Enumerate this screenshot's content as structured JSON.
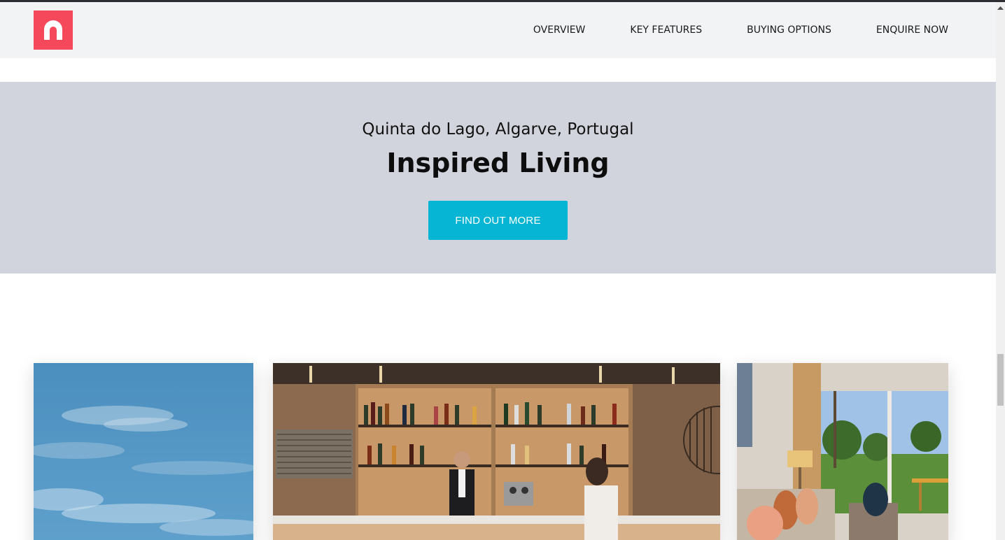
{
  "header": {
    "logo_name": "brand-logo",
    "nav": [
      {
        "label": "OVERVIEW"
      },
      {
        "label": "KEY FEATURES"
      },
      {
        "label": "BUYING OPTIONS"
      },
      {
        "label": "ENQUIRE NOW"
      }
    ]
  },
  "hero": {
    "location": "Quinta do Lago, Algarve, Portugal",
    "title": "Inspired Living",
    "cta_label": "FIND OUT MORE"
  },
  "colors": {
    "brand": "#f5485a",
    "accent": "#06b5d4",
    "hero_bg": "#d1d4dc",
    "header_bg": "#f2f3f5"
  },
  "gallery": {
    "images": [
      "sky-photo",
      "bar-photo",
      "living-room-photo"
    ]
  }
}
